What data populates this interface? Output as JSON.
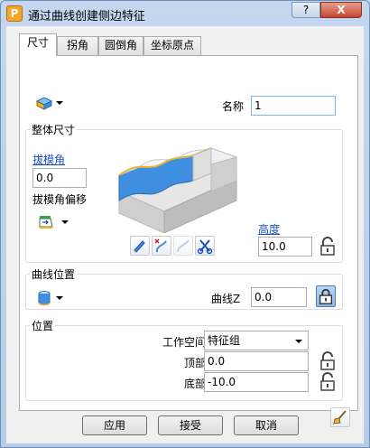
{
  "window": {
    "title": "通过曲线创建侧边特征",
    "help_label": "?",
    "close_label": "X"
  },
  "tabs": [
    {
      "label": "尺寸",
      "active": true
    },
    {
      "label": "拐角",
      "active": false
    },
    {
      "label": "圆倒角",
      "active": false
    },
    {
      "label": "坐标原点",
      "active": false
    }
  ],
  "header": {
    "name_label": "名称",
    "name_value": "1"
  },
  "overall": {
    "group_label": "整体尺寸",
    "draft_angle_label": "拔模角",
    "draft_angle_value": "0.0",
    "draft_offset_label": "拔模角偏移",
    "height_label": "高度",
    "height_value": "10.0"
  },
  "curve_position": {
    "group_label": "曲线位置",
    "curve_z_label": "曲线Z",
    "curve_z_value": "0.0"
  },
  "position": {
    "group_label": "位置",
    "workspace_label": "工作空间",
    "workspace_value": "特征组",
    "top_label": "顶部",
    "top_value": "0.0",
    "bottom_label": "底部",
    "bottom_value": "-10.0"
  },
  "footer": {
    "apply_label": "应用",
    "accept_label": "接受",
    "cancel_label": "取消"
  },
  "colors": {
    "accent_link": "#1a4fbf",
    "feature_blue": "#3f8fe0",
    "feature_gray": "#d9d9d9"
  }
}
